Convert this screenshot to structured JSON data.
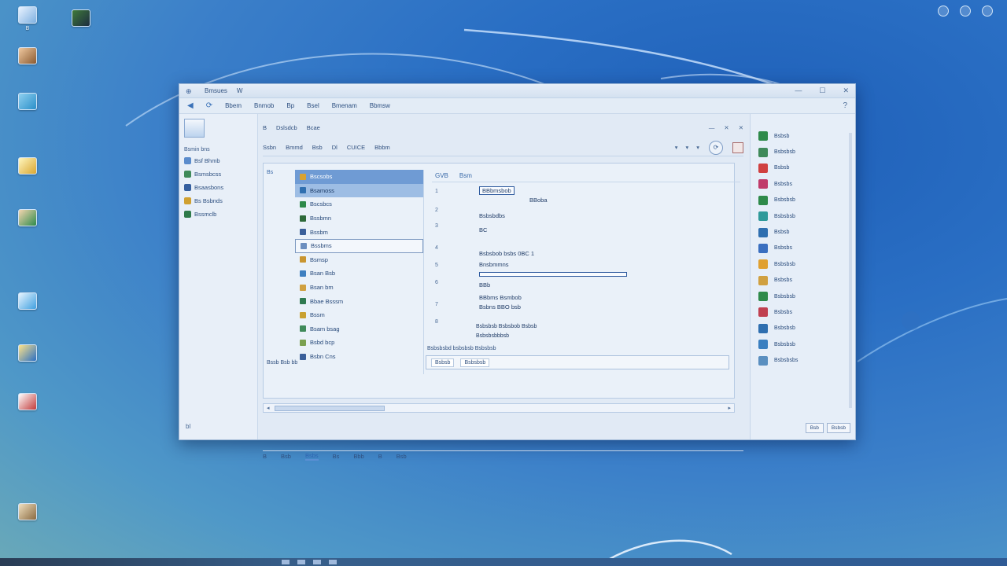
{
  "desktop": {
    "icons": [
      {
        "label": "B"
      },
      {
        "label": ""
      },
      {
        "label": ""
      },
      {
        "label": ""
      },
      {
        "label": ""
      },
      {
        "label": ""
      },
      {
        "label": ""
      },
      {
        "label": ""
      },
      {
        "label": ""
      },
      {
        "label": ""
      }
    ],
    "tray_top": [
      "",
      "",
      ""
    ]
  },
  "window": {
    "title": "Bmsues",
    "title2": "W",
    "controls": [
      "—",
      "☐",
      "✕"
    ],
    "menu": [
      "Bbem",
      "Bnmob",
      "Bp",
      "Bsel",
      "Bmenam",
      "Bbmsw"
    ],
    "nav": {
      "big_label": "Bsmin bns",
      "rows": [
        "Bsf Bhmb",
        "Bsmsbcss",
        "Bsaasbons",
        "Bs Bsbnds",
        "Bssmclb"
      ],
      "foot": "bl"
    },
    "toolbar1": {
      "items": [
        "B",
        "Dslsdcb",
        "Bcae"
      ],
      "ctrls": [
        "—",
        "✕",
        "✕"
      ]
    },
    "toolbar2": {
      "items": [
        "Ssbn",
        "Bmmd",
        "Bsb",
        "Dl",
        "CUICE",
        "Bbbm"
      ]
    },
    "list": [
      {
        "label": "Bscsobs",
        "sel": "sel"
      },
      {
        "label": "Bsamoss",
        "sel": "sel2"
      },
      {
        "label": "Bscsbcs",
        "sel": ""
      },
      {
        "label": "Bssbmn",
        "sel": ""
      },
      {
        "label": "Bssbm",
        "sel": ""
      },
      {
        "label": "Bssbms",
        "sel": "boxed"
      },
      {
        "label": "Bsmsp",
        "sel": ""
      },
      {
        "label": "Bsan Bsb",
        "sel": ""
      },
      {
        "label": "Bsan bm",
        "sel": ""
      },
      {
        "label": "Bbae Bsssm",
        "sel": ""
      },
      {
        "label": "Bssm",
        "sel": ""
      },
      {
        "label": "Bsam bsag",
        "sel": ""
      },
      {
        "label": "Bsbd bcp",
        "sel": ""
      },
      {
        "label": "Bsbn Cns",
        "sel": ""
      }
    ],
    "left_strip": [
      "Bs"
    ],
    "bottom_left": "Bssb Bsb bb",
    "detail": {
      "header": [
        "GVB",
        "Bsm"
      ],
      "highlight": "BBbmsbob",
      "sub": "BBoba",
      "lines": [
        "Bsbsbdbs",
        "BC",
        "Bsbsbob bsbs 0BC 1",
        "Bnsbmmns",
        "BBb",
        "BBbms Bsmbob",
        "Bsbns BBO bsb"
      ],
      "wide_lines": [
        "Bsbsbsb Bsbsbob Bsbsb",
        "Bsbsbsbbbsb"
      ],
      "note": "Bsbsbsbd bsbsbsb Bsbsbsb"
    },
    "input_row": [
      "Bsbsb",
      "Bsbsbsb"
    ],
    "status": [
      "B",
      "Bsb",
      "Bsbs",
      "Bs",
      "Bbb",
      "B",
      "Bsb"
    ],
    "side": {
      "items": [
        "Bsbsb",
        "Bsbsbsb",
        "Bsbsb",
        "Bsbsbs",
        "Bsbsbsb",
        "Bsbsbsb",
        "Bsbsb",
        "Bsbsbs",
        "Bsbsbsb",
        "Bsbsbs",
        "Bsbsbsb",
        "Bsbsbs",
        "Bsbsbsb",
        "Bsbsbsb",
        "Bsbsbsbs"
      ],
      "buttons": [
        "Bsb",
        "Bsbsb"
      ]
    }
  },
  "taskbar": {
    "clock": ""
  }
}
